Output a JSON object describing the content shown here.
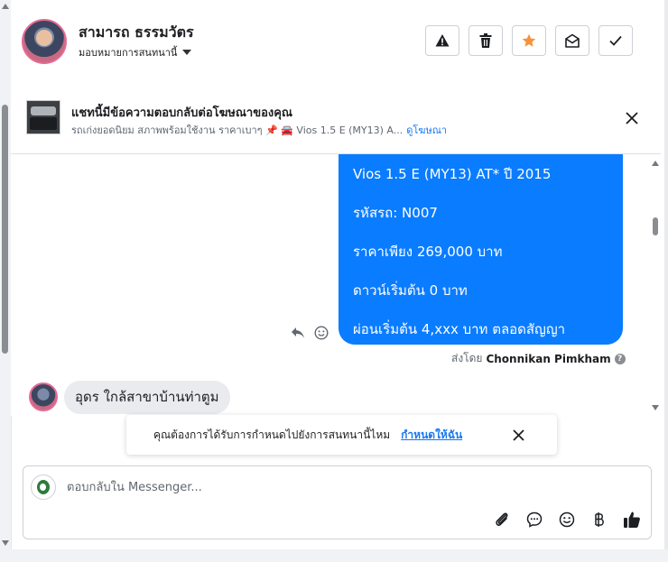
{
  "header": {
    "user_name": "สามารถ ธรรมวัตร",
    "assign_label": "มอบหมายการสนทนานี้"
  },
  "ad": {
    "title": "แชทนี้มีข้อความตอบกลับต่อโฆษณาของคุณ",
    "subtitle": "รถเก่งยอดนิยม สภาพพร้อมใช้งาน ราคาเบาๆ 📌 🚘 Vios 1.5 E (MY13) A...",
    "link": "ดูโฆษณา"
  },
  "messages": {
    "outgoing_lines": [
      "Vios 1.5 E (MY13) AT* ปี 2015",
      "รหัสรถ: N007",
      "ราคาเพียง 269,000 บาท",
      "ดาวน์เริ่มต้น 0 บาท",
      "ผ่อนเริ่มต้น 4,xxx บาท ตลอดสัญญา"
    ],
    "sent_by_prefix": "ส่งโดย",
    "sent_by_name": "Chonnikan Pimkham",
    "incoming": "อุดร ใกล้สาขาบ้านท่าตูม"
  },
  "toast": {
    "text": "คุณต้องการได้รับการกำหนดไปยังการสนทนานี้ไหม",
    "link": "กำหนดให้ฉัน"
  },
  "composer": {
    "placeholder": "ตอบกลับใน Messenger..."
  },
  "colors": {
    "accent": "#1877f2",
    "bubble_out": "#0a7cff",
    "star": "#f7923b"
  },
  "icons": [
    "warning-icon",
    "trash-icon",
    "star-icon",
    "envelope-open-icon",
    "check-icon",
    "caret-down-icon",
    "close-icon",
    "reply-icon",
    "emoji-icon",
    "info-icon",
    "attach-icon",
    "saved-reply-icon",
    "emoji-icon",
    "baht-icon",
    "thumbs-up-icon"
  ]
}
